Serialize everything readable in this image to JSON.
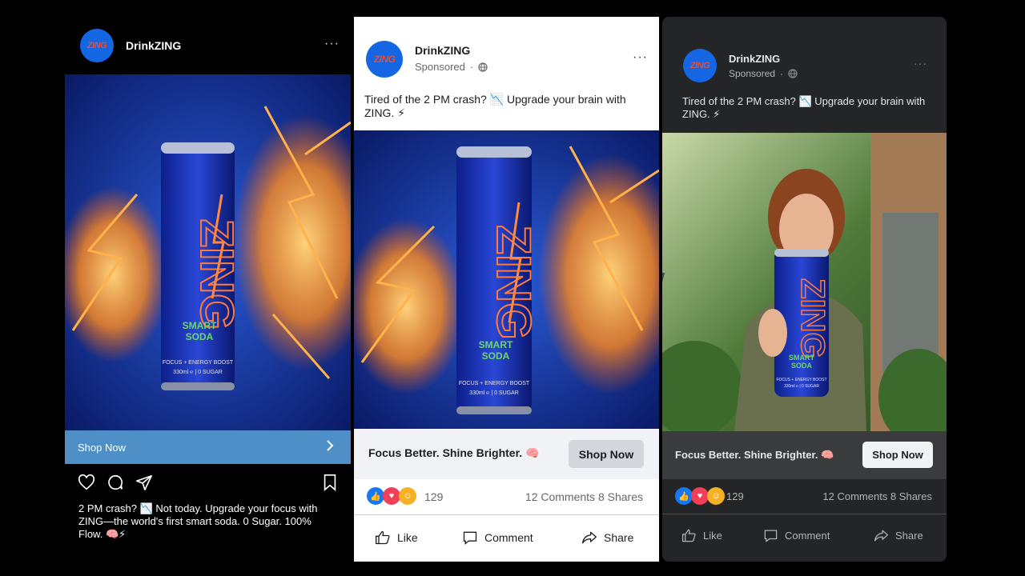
{
  "brand": {
    "name": "DrinkZING",
    "avatar_text": "ZING"
  },
  "instagram": {
    "cta_label": "Shop Now",
    "caption": "2 PM crash? 📉 Not today. Upgrade your focus with ZING—the world's first smart soda. 0 Sugar. 100% Flow. 🧠⚡",
    "more_label": "···"
  },
  "facebook_light": {
    "sponsored": "Sponsored",
    "post_text": "Tired of the 2 PM crash? 📉 Upgrade your brain with ZING. ⚡",
    "headline": "Focus Better. Shine Brighter. 🧠",
    "cta_label": "Shop Now",
    "reaction_count": "129",
    "comments": "12 Comments",
    "shares": "8 Shares",
    "actions": {
      "like": "Like",
      "comment": "Comment",
      "share": "Share"
    },
    "more_label": "···"
  },
  "facebook_dark": {
    "sponsored": "Sponsored",
    "post_text": "Tired of the 2 PM crash? 📉 Upgrade your brain with ZING. ⚡",
    "headline": "Focus Better. Shine Brighter. 🧠",
    "cta_label": "Shop Now",
    "reaction_count": "129",
    "comments": "12 Comments",
    "shares": "8 Shares",
    "actions": {
      "like": "Like",
      "comment": "Comment",
      "share": "Share"
    },
    "more_label": "···"
  },
  "can": {
    "brand": "ZING",
    "tagline_1": "SMART",
    "tagline_2": "SODA",
    "spec_1": "FOCUS + ENERGY BOOST",
    "spec_2": "330ml ℮ | 0 SUGAR"
  },
  "colors": {
    "brand_blue": "#1466e3",
    "brand_orange": "#e2503c",
    "ig_cta": "#4d8fc6",
    "fb_like": "#1877f2",
    "fb_love": "#f33e58"
  }
}
